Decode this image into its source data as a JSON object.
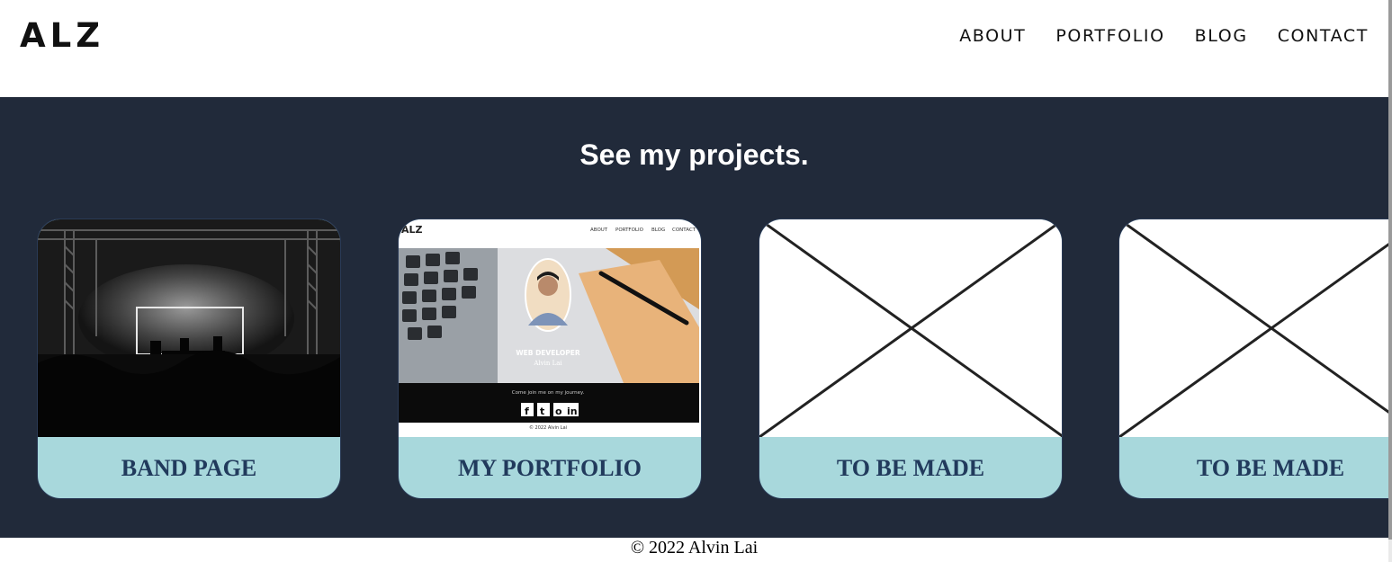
{
  "header": {
    "logo": "ALZ",
    "nav": [
      "ABOUT",
      "PORTFOLIO",
      "BLOG",
      "CONTACT"
    ]
  },
  "projects": {
    "heading": "See my projects.",
    "cards": [
      {
        "label": "BAND PAGE",
        "thumbnail": "concert-stage-image"
      },
      {
        "label": "MY PORTFOLIO",
        "thumbnail": "portfolio-screenshot-image",
        "preview": {
          "logo": "ALZ",
          "nav": [
            "ABOUT",
            "PORTFOLIO",
            "BLOG",
            "CONTACT"
          ],
          "title": "WEB DEVELOPER",
          "name": "Alvin Lai",
          "footer_text": "Come join me on my journey.",
          "copyright": "© 2022 Alvin Lai"
        }
      },
      {
        "label": "TO BE MADE",
        "thumbnail": "placeholder-x-image"
      },
      {
        "label": "TO BE MADE",
        "thumbnail": "placeholder-x-image"
      }
    ]
  },
  "footer": {
    "copyright": "© 2022 Alvin Lai"
  },
  "colors": {
    "dark": "#212a3a",
    "card_label_bg": "#a8d8dc",
    "card_label_text": "#213a5c"
  }
}
